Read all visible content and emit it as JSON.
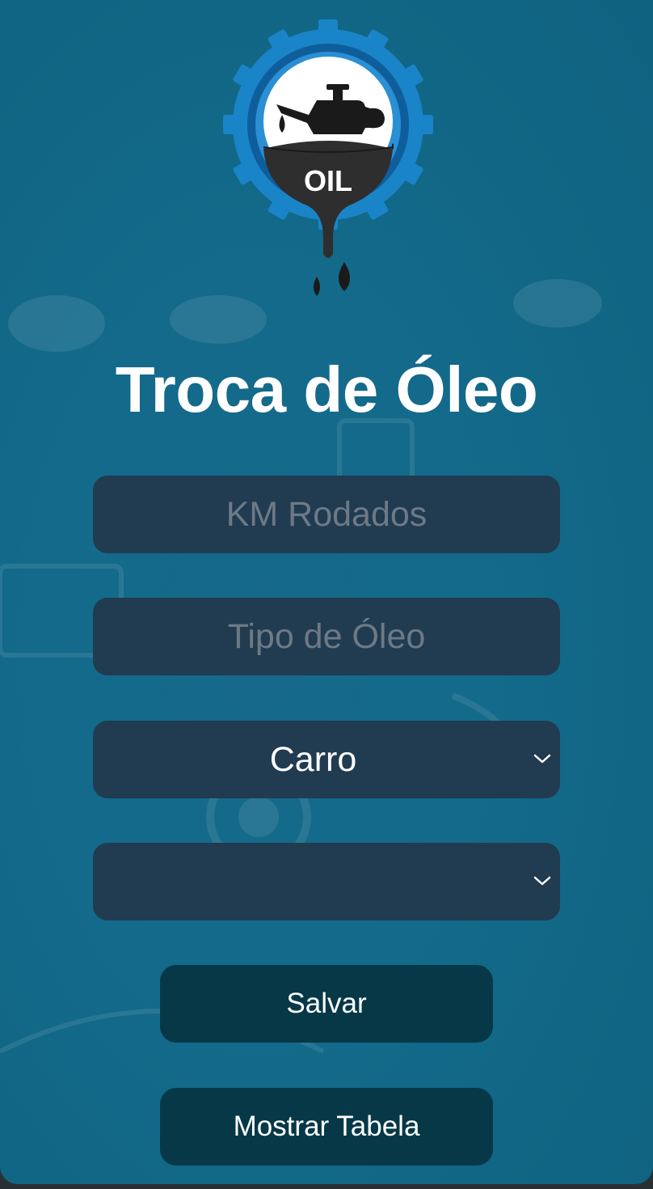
{
  "app": {
    "title": "Troca de Óleo",
    "logo_label": "OIL"
  },
  "form": {
    "km_input": {
      "value": "",
      "placeholder": "KM Rodados"
    },
    "oil_type_input": {
      "value": "",
      "placeholder": "Tipo de Óleo"
    },
    "vehicle_select": {
      "selected": "Carro"
    },
    "model_select": {
      "selected": ""
    }
  },
  "actions": {
    "save_label": "Salvar",
    "show_table_label": "Mostrar Tabela"
  },
  "icons": {
    "logo": "oil-can-gear-logo-icon",
    "select_arrow": "chevron-down-icon"
  },
  "colors": {
    "background": "#136a8a",
    "field_bg": "#213b51",
    "button_bg": "#073847",
    "logo_blue": "#1a84c8",
    "placeholder": "#6d7a86"
  }
}
